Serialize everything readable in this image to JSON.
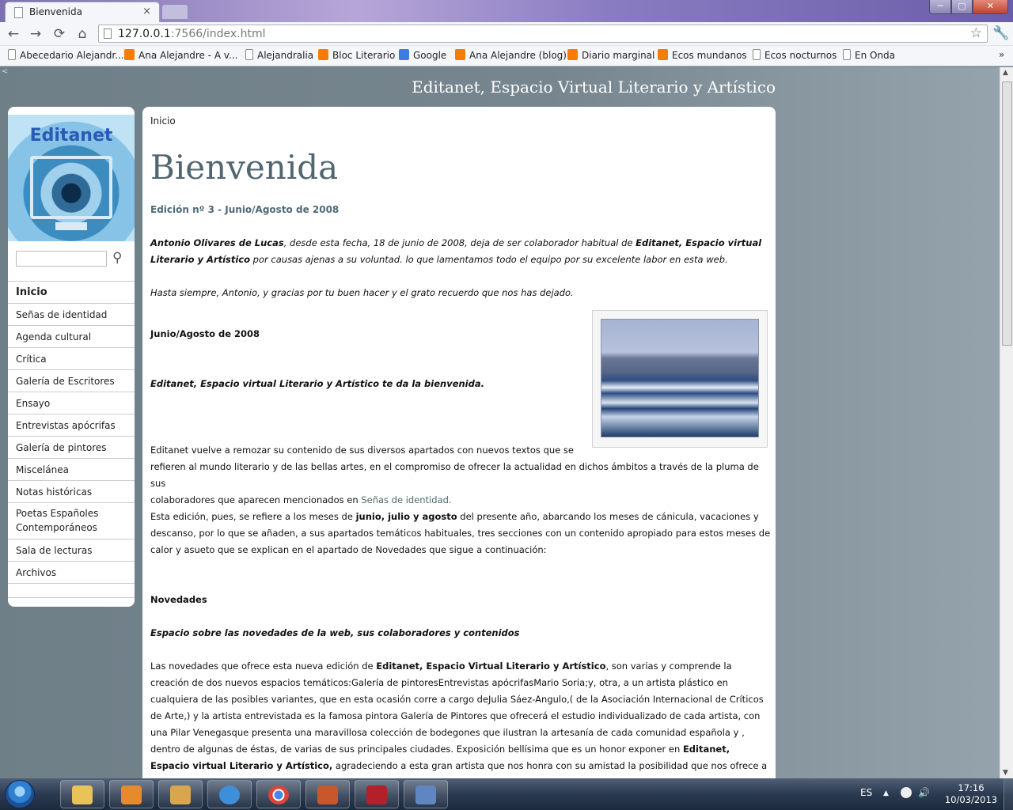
{
  "browser": {
    "tab_title": "Bienvenida",
    "tab_close": "×",
    "url_host": "127.0.0.1",
    "url_rest": ":7566/index.html",
    "win_min": "─",
    "win_max": "▢",
    "win_close": "✕",
    "back": "←",
    "forward": "→",
    "reload": "⟳",
    "home": "⌂",
    "star": "☆",
    "wrench": "🔧",
    "bookmarks": [
      {
        "label": "Abecedario Alejandr...",
        "icon": "page-icon"
      },
      {
        "label": "Ana Alejandre - A v...",
        "icon": "blogger-icon"
      },
      {
        "label": "Alejandralia",
        "icon": "page-icon"
      },
      {
        "label": "Bloc Literario",
        "icon": "blogger-icon"
      },
      {
        "label": "Google",
        "icon": "google-icon"
      },
      {
        "label": "Ana Alejandre (blog)",
        "icon": "blogger-icon"
      },
      {
        "label": "Diario marginal",
        "icon": "blogger-icon"
      },
      {
        "label": "Ecos mundanos",
        "icon": "blogger-icon"
      },
      {
        "label": "Ecos nocturnos",
        "icon": "page-icon"
      },
      {
        "label": "En Onda",
        "icon": "page-icon"
      }
    ],
    "bookmarks_more": "»"
  },
  "page": {
    "corner_mark": "<",
    "site_title": "Editanet, Espacio Virtual Literario y Artístico",
    "logo_text": "Editanet",
    "search_icon": "⚲",
    "menu": [
      "Inicio",
      "Señas de identidad",
      "Agenda cultural",
      "Crítica",
      "Galería de Escritores",
      "Ensayo",
      "Entrevistas apócrifas",
      "Galería de pintores",
      "Miscelánea",
      "Notas históricas",
      "Poetas Españoles Contemporáneos",
      "Sala de lecturas",
      "Archivos"
    ],
    "breadcrumb": "Inicio",
    "title": "Bienvenida",
    "subtitle": "Edición nº 3 - Junio/Agosto de 2008",
    "p1_name": "Antonio Olivares de Lucas",
    "p1_a": ", desde esta fecha, 18 de junio de 2008, deja de ser colaborador habitual de ",
    "p1_site": "Editanet, Espacio virtual Literario y Artístico",
    "p1_b": " por causas ajenas a su voluntad. lo que lamentamos todo el equipo por su excelente labor en esta web.",
    "p2": "Hasta siempre, Antonio, y gracias por tu buen hacer y el grato recuerdo que nos has dejado.",
    "h_edition": "Junio/Agosto de 2008",
    "welcome": "Editanet, Espacio virtual Literario y Artístico te da la bienvenida.",
    "p3_l1": "Editanet vuelve a remozar su contenido de sus diversos apartados con nuevos textos que se",
    "p3_l2": "refieren al mundo literario y de las bellas artes, en el compromiso de ofrecer la actualidad en dichos ámbitos a través de la pluma de sus",
    "p3_l3": "colaboradores que aparecen mencionados en ",
    "p3_link": "Señas de identidad.",
    "p4_a": "Esta edición, pues, se refiere a los meses de ",
    "p4_bold": "junio, julio y agosto",
    "p4_b": " del presente año, abarcando los meses de cánicula, vacaciones y descanso, por lo que se añaden, a sus apartados temáticos habituales, tres secciones con un contenido apropiado para estos meses de calor y asueto que se explican en el apartado de Novedades que sigue a continuación:",
    "h_news": "Novedades",
    "news_sub": "Espacio sobre las novedades de la web, sus colaboradores y contenidos",
    "p5_a": "Las novedades que ofrece esta nueva edición de ",
    "p5_site": "Editanet, Espacio Virtual Literario y Artístico",
    "p5_b": ", son varias y comprende la creación de dos nuevos espacios temáticos:Galería de pintoresEntrevistas apócrifasMario Soria;y, otra, a un artista plástico en cualquiera de las posibles variantes, que en esta ocasión corre a cargo deJulia Sáez-Angulo,( de la Asociación Internacional de Críticos de Arte,) y la artista entrevistada es la famosa pintora Galería de Pintores que ofrecerá el estudio individualizado de cada artista, con una Pilar Venegasque presenta una maravillosa colección de bodegones que ilustran la artesanía de cada comunidad española y , dentro de algunas de éstas, de varias de sus principales ciudades. Exposición bellísima que es un honor exponer en ",
    "p5_site2": "Editanet, Espacio virtual Literario y Artístico,",
    "p5_c": " agradeciendo a esta gran artista que nos honra con su amistad la posibilidad que nos ofrece a quienes hacemos esta web y a sus lectores"
  },
  "taskbar": {
    "lang": "ES",
    "tray_up": "▲",
    "speaker": "🔊",
    "time": "17:16",
    "date": "10/03/2013"
  },
  "scrollbar": {
    "up": "▲",
    "down": "▼"
  }
}
